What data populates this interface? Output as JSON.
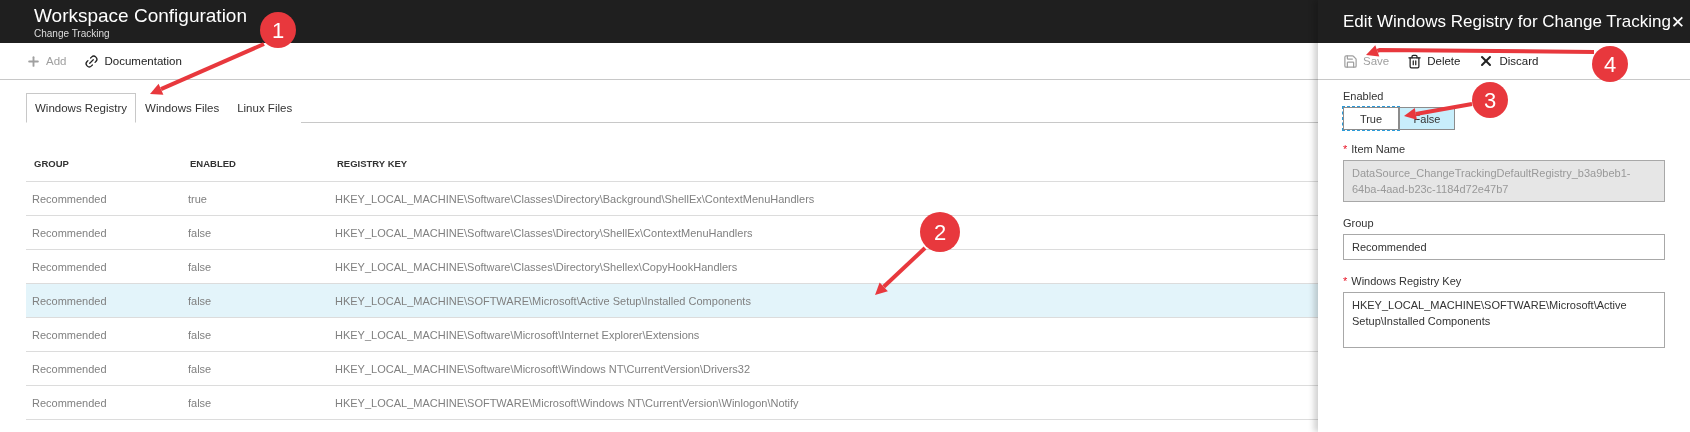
{
  "blade": {
    "title": "Workspace Configuration",
    "subtitle": "Change Tracking"
  },
  "toolbar": [
    {
      "label": "Add",
      "kind": "add",
      "disabled": true
    },
    {
      "label": "Documentation",
      "kind": "link",
      "disabled": false
    }
  ],
  "tabs": [
    {
      "label": "Windows Registry",
      "selected": true
    },
    {
      "label": "Windows Files",
      "selected": false
    },
    {
      "label": "Linux Files",
      "selected": false
    }
  ],
  "table": {
    "columns": [
      "GROUP",
      "ENABLED",
      "REGISTRY KEY"
    ],
    "rows": [
      {
        "cells": [
          "Recommended",
          "true",
          "HKEY_LOCAL_MACHINE\\Software\\Classes\\Directory\\Background\\ShellEx\\ContextMenuHandlers"
        ],
        "selected": false
      },
      {
        "cells": [
          "Recommended",
          "false",
          "HKEY_LOCAL_MACHINE\\Software\\Classes\\Directory\\ShellEx\\ContextMenuHandlers"
        ],
        "selected": false
      },
      {
        "cells": [
          "Recommended",
          "false",
          "HKEY_LOCAL_MACHINE\\Software\\Classes\\Directory\\Shellex\\CopyHookHandlers"
        ],
        "selected": false
      },
      {
        "cells": [
          "Recommended",
          "false",
          "HKEY_LOCAL_MACHINE\\SOFTWARE\\Microsoft\\Active Setup\\Installed Components"
        ],
        "selected": true
      },
      {
        "cells": [
          "Recommended",
          "false",
          "HKEY_LOCAL_MACHINE\\Software\\Microsoft\\Internet Explorer\\Extensions"
        ],
        "selected": false
      },
      {
        "cells": [
          "Recommended",
          "false",
          "HKEY_LOCAL_MACHINE\\Software\\Microsoft\\Windows NT\\CurrentVersion\\Drivers32"
        ],
        "selected": false
      },
      {
        "cells": [
          "Recommended",
          "false",
          "HKEY_LOCAL_MACHINE\\SOFTWARE\\Microsoft\\Windows NT\\CurrentVersion\\Winlogon\\Notify"
        ],
        "selected": false
      }
    ]
  },
  "panel": {
    "title": "Edit Windows Registry for Change Tracking",
    "close": "✕",
    "toolbar": [
      {
        "label": "Save",
        "kind": "save",
        "disabled": true
      },
      {
        "label": "Delete",
        "kind": "delete",
        "disabled": false
      },
      {
        "label": "Discard",
        "kind": "discard",
        "disabled": false
      }
    ],
    "enabled": {
      "label": "Enabled",
      "options": [
        {
          "label": "True",
          "selected": false,
          "focused": true
        },
        {
          "label": "False",
          "selected": true,
          "focused": false
        }
      ]
    },
    "fields": [
      {
        "label": "Item Name",
        "marker": "*",
        "disabled": true,
        "value": "DataSource_ChangeTrackingDefaultRegistry_b3a9beb1-64ba-4aad-b23c-1184d72e47b7"
      },
      {
        "label": "Group",
        "disabled": false,
        "value": "Recommended"
      },
      {
        "label": "Windows Registry Key",
        "marker": "*",
        "disabled": false,
        "value": "HKEY_LOCAL_MACHINE\\SOFTWARE\\Microsoft\\Active Setup\\Installed Components"
      }
    ]
  },
  "callouts": [
    {
      "number": "1"
    },
    {
      "number": "2"
    },
    {
      "number": "3"
    },
    {
      "number": "4"
    }
  ]
}
